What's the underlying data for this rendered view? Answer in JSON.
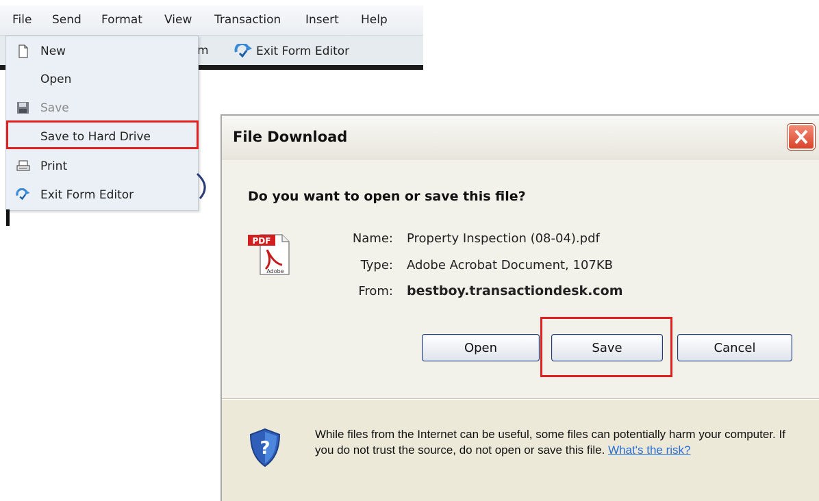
{
  "menubar": {
    "items": [
      "File",
      "Send",
      "Format",
      "View",
      "Transaction",
      "Insert",
      "Help"
    ]
  },
  "toolbar": {
    "partial_label": "m",
    "exit_form_editor": "Exit Form Editor"
  },
  "file_menu": {
    "items": [
      {
        "label": "New",
        "icon": "new-document-icon",
        "enabled": true
      },
      {
        "label": "Open",
        "icon": "",
        "enabled": true
      },
      {
        "label": "Save",
        "icon": "floppy-disk-icon",
        "enabled": false
      },
      {
        "label": "Save to Hard Drive",
        "icon": "",
        "enabled": true,
        "highlighted": true
      },
      {
        "label": "Print",
        "icon": "printer-icon",
        "enabled": true
      },
      {
        "label": "Exit Form Editor",
        "icon": "exit-arrows-icon",
        "enabled": true
      }
    ]
  },
  "dialog": {
    "title": "File Download",
    "question": "Do you want to open or save this file?",
    "file": {
      "name_label": "Name:",
      "name_value": "Property Inspection (08-04).pdf",
      "type_label": "Type:",
      "type_value": "Adobe Acrobat Document, 107KB",
      "from_label": "From:",
      "from_value": "bestboy.transactiondesk.com",
      "icon": "pdf-file-icon",
      "icon_badge": "PDF",
      "icon_caption": "Adobe"
    },
    "buttons": {
      "open": "Open",
      "save": "Save",
      "cancel": "Cancel"
    },
    "warning_text": "While files from the Internet can be useful, some files can potentially harm your computer. If you do not trust the source, do not open or save this file.",
    "risk_link": "What's the risk?"
  },
  "colors": {
    "highlight": "#e0211f",
    "dialog_bg": "#ece9d8",
    "link": "#2a6fd6",
    "close_button": "#d9432a"
  }
}
